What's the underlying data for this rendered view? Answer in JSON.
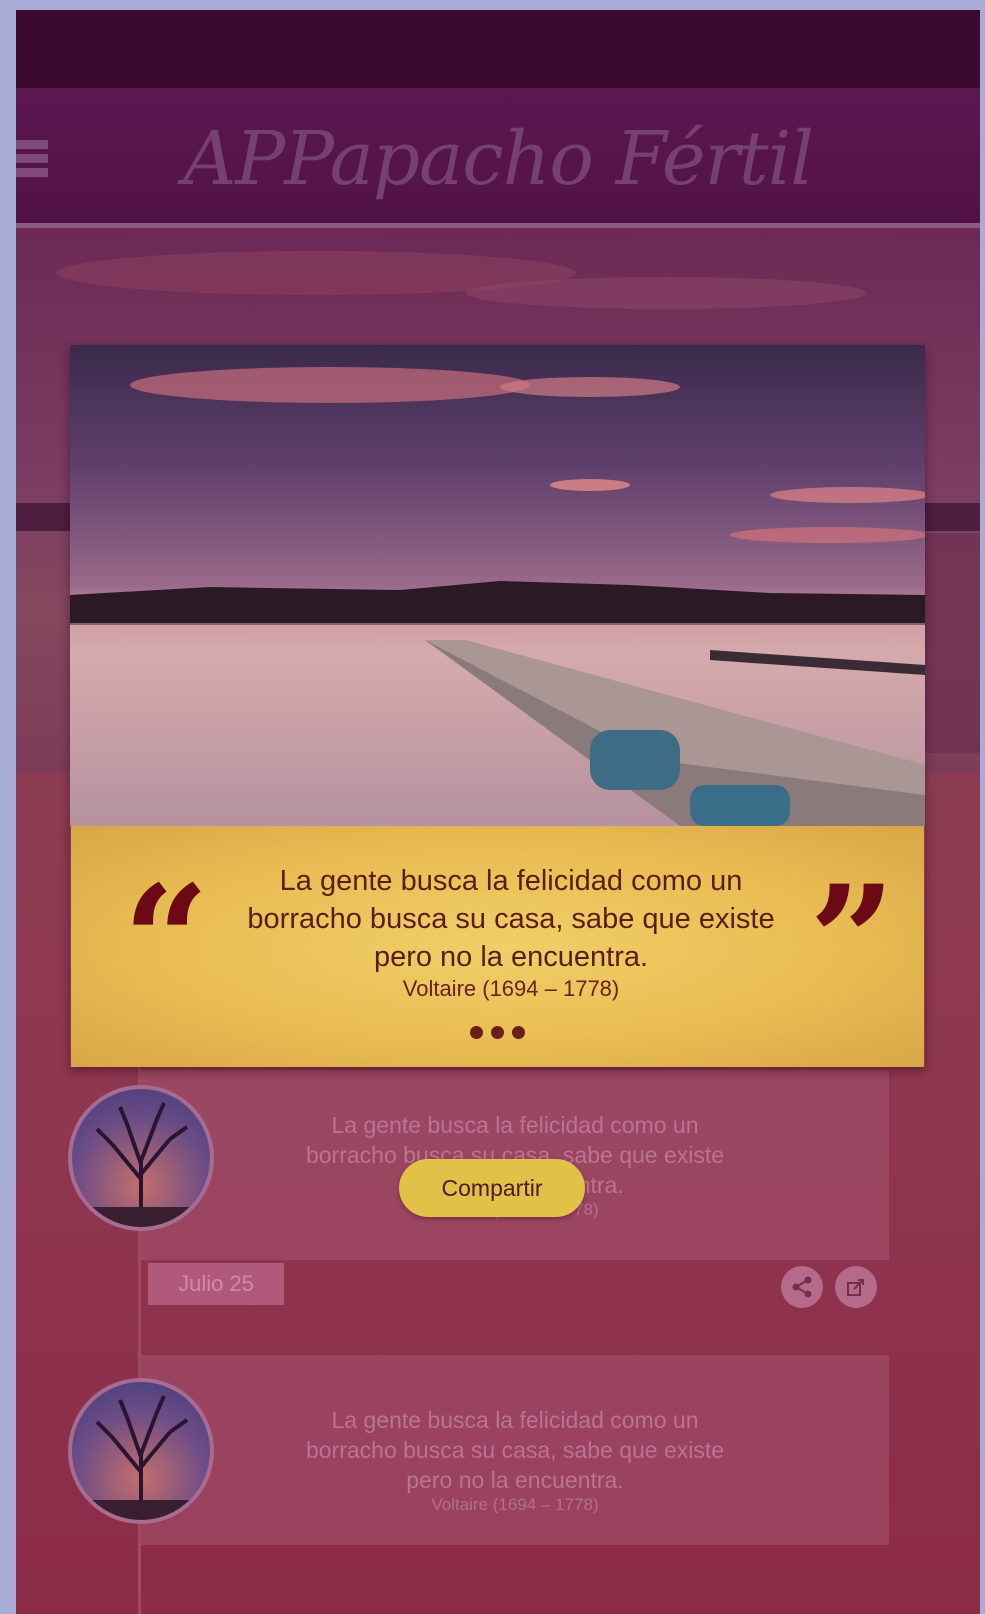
{
  "header": {
    "title": "APPapacho Fértil"
  },
  "modal": {
    "quote": "La gente busca la felicidad como un borracho busca su casa, sabe que existe pero no la encuentra.",
    "author": "Voltaire (1694 – 1778)"
  },
  "feed": [
    {
      "quote": "La gente busca la felicidad como un borracho busca su casa, sabe que existe pero no la encuentra.",
      "author": "Voltaire (1694 – 1778)",
      "date": "Julio 25"
    },
    {
      "quote": "La gente busca la felicidad como un borracho busca su casa, sabe que existe pero no la encuentra.",
      "author": "Voltaire (1694 – 1778)"
    }
  ],
  "share_button": "Compartir",
  "icons": [
    "menu-icon",
    "share-icon",
    "external-share-icon",
    "open-quote-icon",
    "close-quote-icon",
    "more-dots-icon"
  ],
  "colors": {
    "accent": "#e2c148",
    "header": "#5c1752",
    "quote_mark": "#6b0a16"
  }
}
